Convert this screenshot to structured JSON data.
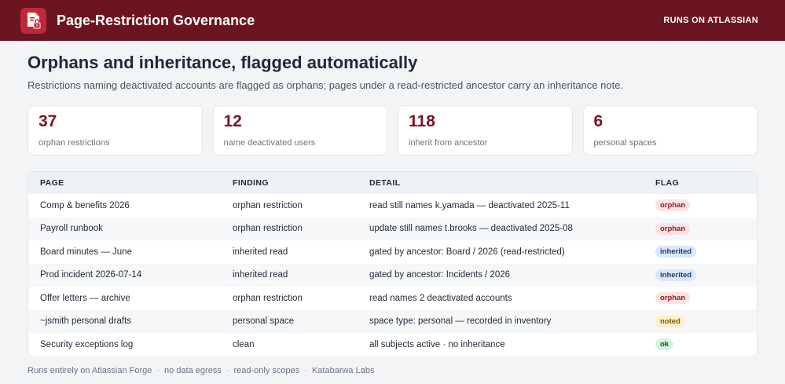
{
  "app": {
    "title": "Page-Restriction Governance",
    "runs_on": "RUNS ON ATLASSIAN",
    "logo_icon": "document-lock-icon"
  },
  "colors": {
    "header_bg": "#6b1520",
    "accent": "#7a1423",
    "logo_bg": "#c0283a"
  },
  "hero": {
    "title": "Orphans and inheritance, flagged automatically",
    "subtitle": "Restrictions naming deactivated accounts are flagged as orphans; pages under a read-restricted ancestor carry an inheritance note."
  },
  "stats": [
    {
      "value": "37",
      "label": "orphan restrictions"
    },
    {
      "value": "12",
      "label": "name deactivated users"
    },
    {
      "value": "118",
      "label": "inherit from ancestor"
    },
    {
      "value": "6",
      "label": "personal spaces"
    }
  ],
  "table": {
    "headers": {
      "page": "PAGE",
      "finding": "FINDING",
      "detail": "DETAIL",
      "flag": "FLAG"
    },
    "rows": [
      {
        "page": "Comp & benefits 2026",
        "finding": "orphan restriction",
        "detail": "read still names k.yamada — deactivated 2025-11",
        "flag": "orphan",
        "flag_type": "orphan"
      },
      {
        "page": "Payroll runbook",
        "finding": "orphan restriction",
        "detail": "update still names t.brooks — deactivated 2025-08",
        "flag": "orphan",
        "flag_type": "orphan"
      },
      {
        "page": "Board minutes — June",
        "finding": "inherited read",
        "detail": "gated by ancestor: Board / 2026 (read-restricted)",
        "flag": "inherited",
        "flag_type": "inherited"
      },
      {
        "page": "Prod incident 2026-07-14",
        "finding": "inherited read",
        "detail": "gated by ancestor: Incidents / 2026",
        "flag": "inherited",
        "flag_type": "inherited"
      },
      {
        "page": "Offer letters — archive",
        "finding": "orphan restriction",
        "detail": "read names 2 deactivated accounts",
        "flag": "orphan",
        "flag_type": "orphan"
      },
      {
        "page": "~jsmith personal drafts",
        "finding": "personal space",
        "detail": "space type: personal — recorded in inventory",
        "flag": "noted",
        "flag_type": "noted"
      },
      {
        "page": "Security exceptions log",
        "finding": "clean",
        "detail": "all subjects active · no inheritance",
        "flag": "ok",
        "flag_type": "ok"
      }
    ]
  },
  "footer": {
    "items": [
      "Runs entirely on Atlassian Forge",
      "no data egress",
      "read-only scopes",
      "Katabarwa Labs"
    ],
    "separator": "·"
  }
}
